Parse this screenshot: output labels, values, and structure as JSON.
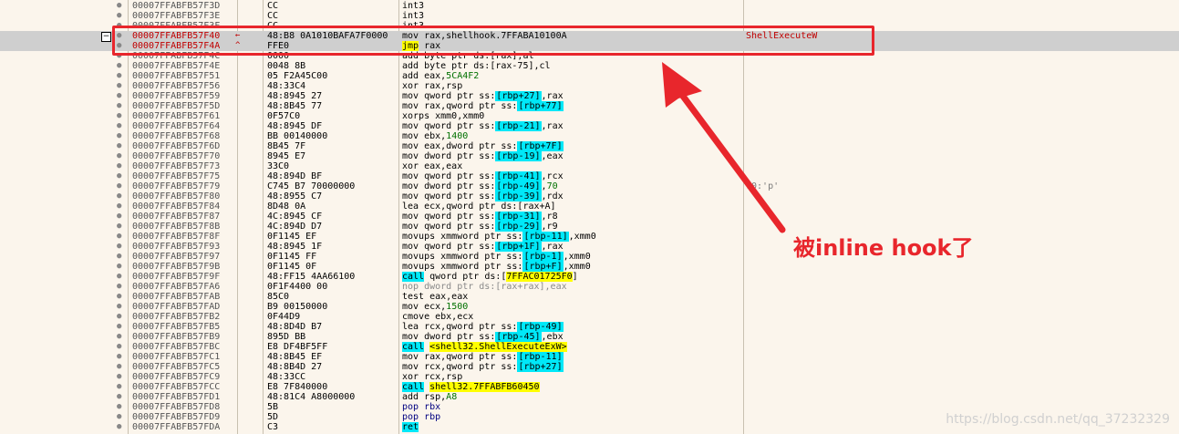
{
  "rows": [
    {
      "addr": "00007FFABFB57F3D",
      "bytes": "CC",
      "dis": [
        [
          "t",
          "int3"
        ]
      ],
      "cmt": ""
    },
    {
      "addr": "00007FFABFB57F3E",
      "bytes": "CC",
      "dis": [
        [
          "t",
          "int3"
        ]
      ],
      "cmt": ""
    },
    {
      "addr": "00007FFABFB57F3F",
      "bytes": "CC",
      "dis": [
        [
          "t",
          "int3"
        ]
      ],
      "cmt": ""
    },
    {
      "addr": "00007FFABFB57F40",
      "arrow": "←",
      "bytes": "48:B8 0A1010BAFA7F0000",
      "dis": [
        [
          "t",
          "mov rax,shellhook.7FFABA10100A"
        ]
      ],
      "cmt": "ShellExecuteW",
      "sel": true,
      "cmtred": true
    },
    {
      "addr": "00007FFABFB57F4A",
      "arrow": "^",
      "bytes": "FFE0",
      "dis": [
        [
          "y",
          "jmp"
        ],
        [
          "t",
          " rax"
        ]
      ],
      "cmt": "",
      "sel": true
    },
    {
      "addr": "00007FFABFB57F4C",
      "bytes": "0000",
      "dis": [
        [
          "t",
          "add byte ptr ds:[rax],al"
        ]
      ],
      "cmt": ""
    },
    {
      "addr": "00007FFABFB57F4E",
      "bytes": "0048 8B",
      "dis": [
        [
          "t",
          "add byte ptr  ds:[rax-75],cl"
        ]
      ],
      "cmt": ""
    },
    {
      "addr": "00007FFABFB57F51",
      "bytes": "05 F2A45C00",
      "dis": [
        [
          "t",
          "add eax,"
        ],
        [
          "g",
          "5CA4F2"
        ]
      ],
      "cmt": ""
    },
    {
      "addr": "00007FFABFB57F56",
      "bytes": "48:33C4",
      "dis": [
        [
          "t",
          "xor rax,rsp"
        ]
      ],
      "cmt": ""
    },
    {
      "addr": "00007FFABFB57F59",
      "bytes": "48:8945 27",
      "dis": [
        [
          "t",
          "mov qword ptr  ss:"
        ],
        [
          "c",
          "[rbp+27]"
        ],
        [
          "t",
          ",rax"
        ]
      ],
      "cmt": ""
    },
    {
      "addr": "00007FFABFB57F5D",
      "bytes": "48:8B45 77",
      "dis": [
        [
          "t",
          "mov rax,qword ptr  ss:"
        ],
        [
          "c",
          "[rbp+77]"
        ]
      ],
      "cmt": ""
    },
    {
      "addr": "00007FFABFB57F61",
      "bytes": "0F57C0",
      "dis": [
        [
          "t",
          "xorps xmm0,xmm0"
        ]
      ],
      "cmt": ""
    },
    {
      "addr": "00007FFABFB57F64",
      "bytes": "48:8945 DF",
      "dis": [
        [
          "t",
          "mov qword ptr  ss:"
        ],
        [
          "c",
          "[rbp-21]"
        ],
        [
          "t",
          ",rax"
        ]
      ],
      "cmt": ""
    },
    {
      "addr": "00007FFABFB57F68",
      "bytes": "BB 00140000",
      "dis": [
        [
          "t",
          "mov ebx,"
        ],
        [
          "g",
          "1400"
        ]
      ],
      "cmt": ""
    },
    {
      "addr": "00007FFABFB57F6D",
      "bytes": "8B45 7F",
      "dis": [
        [
          "t",
          "mov eax,dword ptr  ss:"
        ],
        [
          "c",
          "[rbp+7F]"
        ]
      ],
      "cmt": ""
    },
    {
      "addr": "00007FFABFB57F70",
      "bytes": "8945 E7",
      "dis": [
        [
          "t",
          "mov dword ptr  ss:"
        ],
        [
          "c",
          "[rbp-19]"
        ],
        [
          "t",
          ",eax"
        ]
      ],
      "cmt": ""
    },
    {
      "addr": "00007FFABFB57F73",
      "bytes": "33C0",
      "dis": [
        [
          "t",
          "xor eax,eax"
        ]
      ],
      "cmt": ""
    },
    {
      "addr": "00007FFABFB57F75",
      "bytes": "48:894D BF",
      "dis": [
        [
          "t",
          "mov qword ptr  ss:"
        ],
        [
          "c",
          "[rbp-41]"
        ],
        [
          "t",
          ",rcx"
        ]
      ],
      "cmt": ""
    },
    {
      "addr": "00007FFABFB57F79",
      "bytes": "C745 B7 70000000",
      "dis": [
        [
          "t",
          "mov dword ptr  ss:"
        ],
        [
          "c",
          "[rbp-49]"
        ],
        [
          "t",
          ","
        ],
        [
          "g",
          "70"
        ]
      ],
      "cmt": "70:'p'"
    },
    {
      "addr": "00007FFABFB57F80",
      "bytes": "48:8955 C7",
      "dis": [
        [
          "t",
          "mov qword ptr  ss:"
        ],
        [
          "c",
          "[rbp-39]"
        ],
        [
          "t",
          ",rdx"
        ]
      ],
      "cmt": ""
    },
    {
      "addr": "00007FFABFB57F84",
      "bytes": "8D48 0A",
      "dis": [
        [
          "t",
          "lea ecx,qword ptr  ds:[rax+A]"
        ]
      ],
      "cmt": ""
    },
    {
      "addr": "00007FFABFB57F87",
      "bytes": "4C:8945 CF",
      "dis": [
        [
          "t",
          "mov qword ptr  ss:"
        ],
        [
          "c",
          "[rbp-31]"
        ],
        [
          "t",
          ",r8"
        ]
      ],
      "cmt": ""
    },
    {
      "addr": "00007FFABFB57F8B",
      "bytes": "4C:894D D7",
      "dis": [
        [
          "t",
          "mov qword ptr  ss:"
        ],
        [
          "c",
          "[rbp-29]"
        ],
        [
          "t",
          ",r9"
        ]
      ],
      "cmt": ""
    },
    {
      "addr": "00007FFABFB57F8F",
      "bytes": "0F1145 EF",
      "dis": [
        [
          "t",
          "movups xmmword ptr  ss:"
        ],
        [
          "c",
          "[rbp-11]"
        ],
        [
          "t",
          ",xmm0"
        ]
      ],
      "cmt": ""
    },
    {
      "addr": "00007FFABFB57F93",
      "bytes": "48:8945 1F",
      "dis": [
        [
          "t",
          "mov qword ptr  ss:"
        ],
        [
          "c",
          "[rbp+1F]"
        ],
        [
          "t",
          ",rax"
        ]
      ],
      "cmt": ""
    },
    {
      "addr": "00007FFABFB57F97",
      "bytes": "0F1145 FF",
      "dis": [
        [
          "t",
          "movups xmmword ptr  ss:"
        ],
        [
          "c",
          "[rbp-1]"
        ],
        [
          "t",
          ",xmm0"
        ]
      ],
      "cmt": ""
    },
    {
      "addr": "00007FFABFB57F9B",
      "bytes": "0F1145 0F",
      "dis": [
        [
          "t",
          "movups xmmword ptr  ss:"
        ],
        [
          "c",
          "[rbp+F]"
        ],
        [
          "t",
          ",xmm0"
        ]
      ],
      "cmt": ""
    },
    {
      "addr": "00007FFABFB57F9F",
      "bytes": "48:FF15 4AA66100",
      "dis": [
        [
          "cy",
          "call"
        ],
        [
          "t",
          " qword ptr  ds:["
        ],
        [
          "y",
          "7FFAC01725F0"
        ],
        [
          "t",
          "]"
        ]
      ],
      "cmt": ""
    },
    {
      "addr": "00007FFABFB57FA6",
      "bytes": "0F1F4400 00",
      "dis": [
        [
          "gray",
          "nop dword ptr  ds:[rax+rax],eax"
        ]
      ],
      "cmt": ""
    },
    {
      "addr": "00007FFABFB57FAB",
      "bytes": "85C0",
      "dis": [
        [
          "t",
          "test eax,eax"
        ]
      ],
      "cmt": ""
    },
    {
      "addr": "00007FFABFB57FAD",
      "bytes": "B9 00150000",
      "dis": [
        [
          "t",
          "mov ecx,"
        ],
        [
          "g",
          "1500"
        ]
      ],
      "cmt": ""
    },
    {
      "addr": "00007FFABFB57FB2",
      "bytes": "0F44D9",
      "dis": [
        [
          "t",
          "cmove ebx,ecx"
        ]
      ],
      "cmt": ""
    },
    {
      "addr": "00007FFABFB57FB5",
      "bytes": "48:8D4D B7",
      "dis": [
        [
          "t",
          "lea rcx,qword ptr  ss:"
        ],
        [
          "c",
          "[rbp-49]"
        ]
      ],
      "cmt": ""
    },
    {
      "addr": "00007FFABFB57FB9",
      "bytes": "895D BB",
      "dis": [
        [
          "t",
          "mov dword ptr  ss:"
        ],
        [
          "c",
          "[rbp-45]"
        ],
        [
          "t",
          ",ebx"
        ]
      ],
      "cmt": ""
    },
    {
      "addr": "00007FFABFB57FBC",
      "bytes": "E8 DF4BF5FF",
      "dis": [
        [
          "cy",
          "call"
        ],
        [
          "t",
          " "
        ],
        [
          "y",
          "<shell32.ShellExecuteExW>"
        ]
      ],
      "cmt": ""
    },
    {
      "addr": "00007FFABFB57FC1",
      "bytes": "48:8B45 EF",
      "dis": [
        [
          "t",
          "mov rax,qword ptr  ss:"
        ],
        [
          "c",
          "[rbp-11]"
        ]
      ],
      "cmt": ""
    },
    {
      "addr": "00007FFABFB57FC5",
      "bytes": "48:8B4D 27",
      "dis": [
        [
          "t",
          "mov rcx,qword ptr  ss:"
        ],
        [
          "c",
          "[rbp+27]"
        ]
      ],
      "cmt": ""
    },
    {
      "addr": "00007FFABFB57FC9",
      "bytes": "48:33CC",
      "dis": [
        [
          "t",
          "xor rcx,rsp"
        ]
      ],
      "cmt": ""
    },
    {
      "addr": "00007FFABFB57FCC",
      "bytes": "E8 7F840000",
      "dis": [
        [
          "cy",
          "call"
        ],
        [
          "t",
          " "
        ],
        [
          "y",
          "shell32.7FFABFB60450"
        ]
      ],
      "cmt": ""
    },
    {
      "addr": "00007FFABFB57FD1",
      "bytes": "48:81C4 A8000000",
      "dis": [
        [
          "t",
          "add rsp,"
        ],
        [
          "g",
          "A8"
        ]
      ],
      "cmt": ""
    },
    {
      "addr": "00007FFABFB57FD8",
      "bytes": "5B",
      "dis": [
        [
          "b",
          "pop rbx"
        ]
      ],
      "cmt": ""
    },
    {
      "addr": "00007FFABFB57FD9",
      "bytes": "5D",
      "dis": [
        [
          "b",
          "pop rbp"
        ]
      ],
      "cmt": ""
    },
    {
      "addr": "00007FFABFB57FDA",
      "bytes": "C3",
      "dis": [
        [
          "cy",
          "ret"
        ]
      ],
      "cmt": ""
    }
  ],
  "collapse_symbol": "−",
  "annotation": "被inline hook了",
  "watermark": "https://blog.csdn.net/qq_37232329",
  "colors": {
    "background": "#fbf5ec",
    "selection": "#cfcfcf",
    "highlight_red": "#e8262c",
    "call_cyan": "#00e8f8",
    "label_yellow": "#ffff00"
  }
}
